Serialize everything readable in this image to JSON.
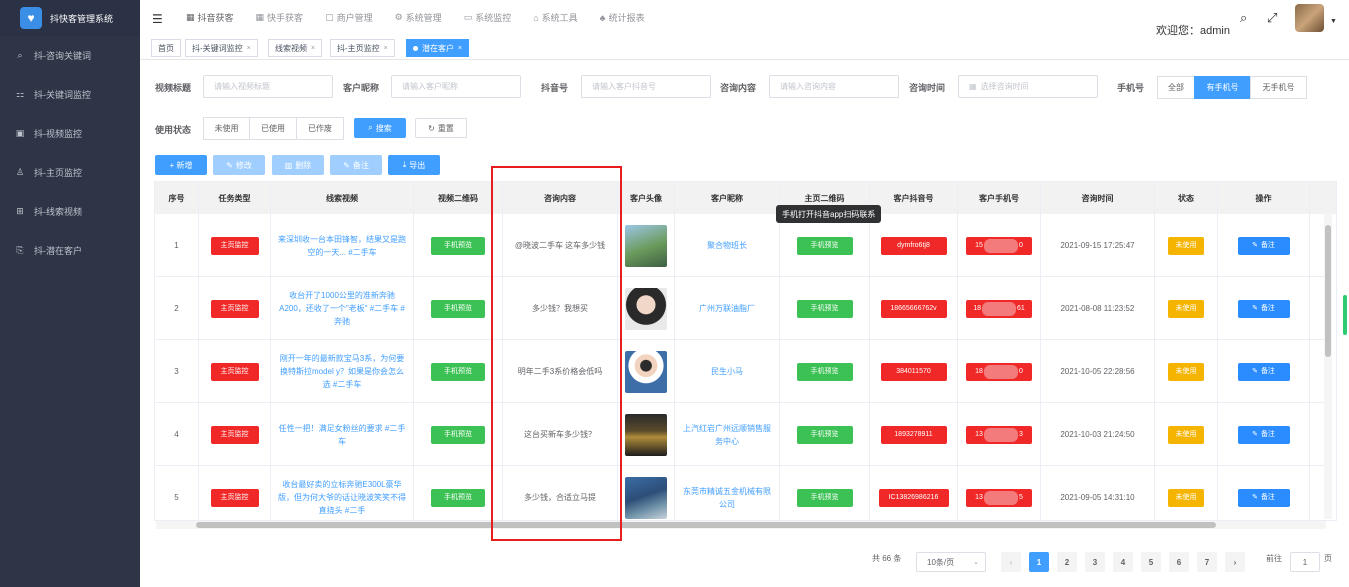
{
  "app": {
    "title": "抖快客管理系统"
  },
  "sidebar": {
    "items": [
      {
        "label": "抖-咨询关键词",
        "icon": "search-icon"
      },
      {
        "label": "抖-关键词监控",
        "icon": "chart-icon"
      },
      {
        "label": "抖-视频监控",
        "icon": "video-icon"
      },
      {
        "label": "抖-主页监控",
        "icon": "user-icon"
      },
      {
        "label": "抖-线索视频",
        "icon": "film-icon"
      },
      {
        "label": "抖-潜在客户",
        "icon": "customer-icon"
      }
    ]
  },
  "header": {
    "nav": [
      {
        "label": "抖音获客",
        "active": true
      },
      {
        "label": "快手获客",
        "active": false
      },
      {
        "label": "商户管理",
        "active": false
      },
      {
        "label": "系统管理",
        "active": false
      },
      {
        "label": "系统监控",
        "active": false
      },
      {
        "label": "系统工具",
        "active": false
      },
      {
        "label": "统计报表",
        "active": false
      }
    ],
    "welcome": "欢迎您：admin"
  },
  "tags": [
    {
      "label": "首页",
      "closable": false,
      "active": false
    },
    {
      "label": "抖-关键词监控",
      "closable": true,
      "active": false
    },
    {
      "label": "线索视频",
      "closable": true,
      "active": false
    },
    {
      "label": "抖-主页监控",
      "closable": true,
      "active": false
    },
    {
      "label": "潜在客户",
      "closable": true,
      "active": true
    }
  ],
  "filters": {
    "video_title": {
      "label": "视频标题",
      "placeholder": "请输入视频标题"
    },
    "nickname": {
      "label": "客户昵称",
      "placeholder": "请输入客户昵称"
    },
    "douyin_id": {
      "label": "抖音号",
      "placeholder": "请输入客户抖音号"
    },
    "content": {
      "label": "咨询内容",
      "placeholder": "请输入咨询内容"
    },
    "time": {
      "label": "咨询时间",
      "placeholder": "选择咨询时间"
    },
    "phone": {
      "label": "手机号",
      "options": [
        "全部",
        "有手机号",
        "无手机号"
      ],
      "selected": "有手机号"
    },
    "status": {
      "label": "使用状态",
      "options": [
        "未使用",
        "已使用",
        "已作废"
      ]
    },
    "search_label": "搜索",
    "reset_label": "重置"
  },
  "toolbar": {
    "add": "+ 新增",
    "edit": "修改",
    "delete": "删除",
    "remark": "备注",
    "export": "导出"
  },
  "table": {
    "columns": [
      "序号",
      "任务类型",
      "线索视频",
      "视频二维码",
      "咨询内容",
      "客户头像",
      "客户昵称",
      "主页二维码",
      "客户抖音号",
      "客户手机号",
      "咨询时间",
      "状态",
      "操作"
    ],
    "rows": [
      {
        "no": "1",
        "type": "主页监控",
        "video": "来深圳收一台本田锋智，结果又是跑空的一天... #二手车",
        "qr": "手机预览",
        "content": "@晓波二手车 这车多少钱",
        "nickname": "聚合物班长",
        "home_qr": "手机预览",
        "douyin": "dymfro6tj8",
        "phone_a": "15",
        "phone_b": "0",
        "time": "2021-09-15 17:25:47",
        "status": "未使用",
        "action": "备注"
      },
      {
        "no": "2",
        "type": "主页监控",
        "video": "收台开了1000公里的准新奔驰A200，还收了一个\"老板\" #二手车 #奔驰",
        "qr": "手机预览",
        "content": "多少钱？我想买",
        "nickname": "广州万联油脂厂",
        "home_qr": "手机预览",
        "douyin": "18665666762v",
        "phone_a": "18",
        "phone_b": "61",
        "time": "2021-08-08 11:23:52",
        "status": "未使用",
        "action": "备注"
      },
      {
        "no": "3",
        "type": "主页监控",
        "video": "刚开一年的最新款宝马3系，为何要换特斯拉model y？如果是你会怎么选 #二手车",
        "qr": "手机预览",
        "content": "明年二手3系价格会低吗",
        "nickname": "民生小马",
        "home_qr": "手机预览",
        "douyin": "384011570",
        "phone_a": "18",
        "phone_b": "0",
        "time": "2021-10-05 22:28:56",
        "status": "未使用",
        "action": "备注"
      },
      {
        "no": "4",
        "type": "主页监控",
        "video": "任性一把！满足女粉丝的要求 #二手车",
        "qr": "手机预览",
        "content": "这台买新车多少钱？",
        "nickname": "上汽红岩广州远顺销售服务中心",
        "home_qr": "手机预览",
        "douyin": "1893278911",
        "phone_a": "13",
        "phone_b": "3",
        "time": "2021-10-03 21:24:50",
        "status": "未使用",
        "action": "备注"
      },
      {
        "no": "5",
        "type": "主页监控",
        "video": "收台最好卖的立标奔驰E300L豪华版，但为何大爷的话让晓波笑笑不得直挠头 #二手",
        "qr": "手机预览",
        "content": "多少钱，合适立马提",
        "nickname": "东莞市精诚五金机械有限公司",
        "home_qr": "手机预览",
        "douyin": "IC13826986216",
        "phone_a": "13",
        "phone_b": "5",
        "time": "2021-09-05 14:31:10",
        "status": "未使用",
        "action": "备注"
      }
    ],
    "tooltip": "手机打开抖音app扫码联系"
  },
  "pagination": {
    "total": "共 66 条",
    "page_size": "10条/页",
    "pages": [
      "1",
      "2",
      "3",
      "4",
      "5",
      "6",
      "7"
    ],
    "current": "1",
    "goto_label": "前往",
    "goto_value": "1",
    "page_suffix": "页"
  },
  "colors": {
    "accent": "#409eff",
    "danger": "#f02828",
    "success": "#3cc154",
    "warning": "#f5b400",
    "sidebar": "#2e3547",
    "highlight_box": "#e81e1e"
  }
}
